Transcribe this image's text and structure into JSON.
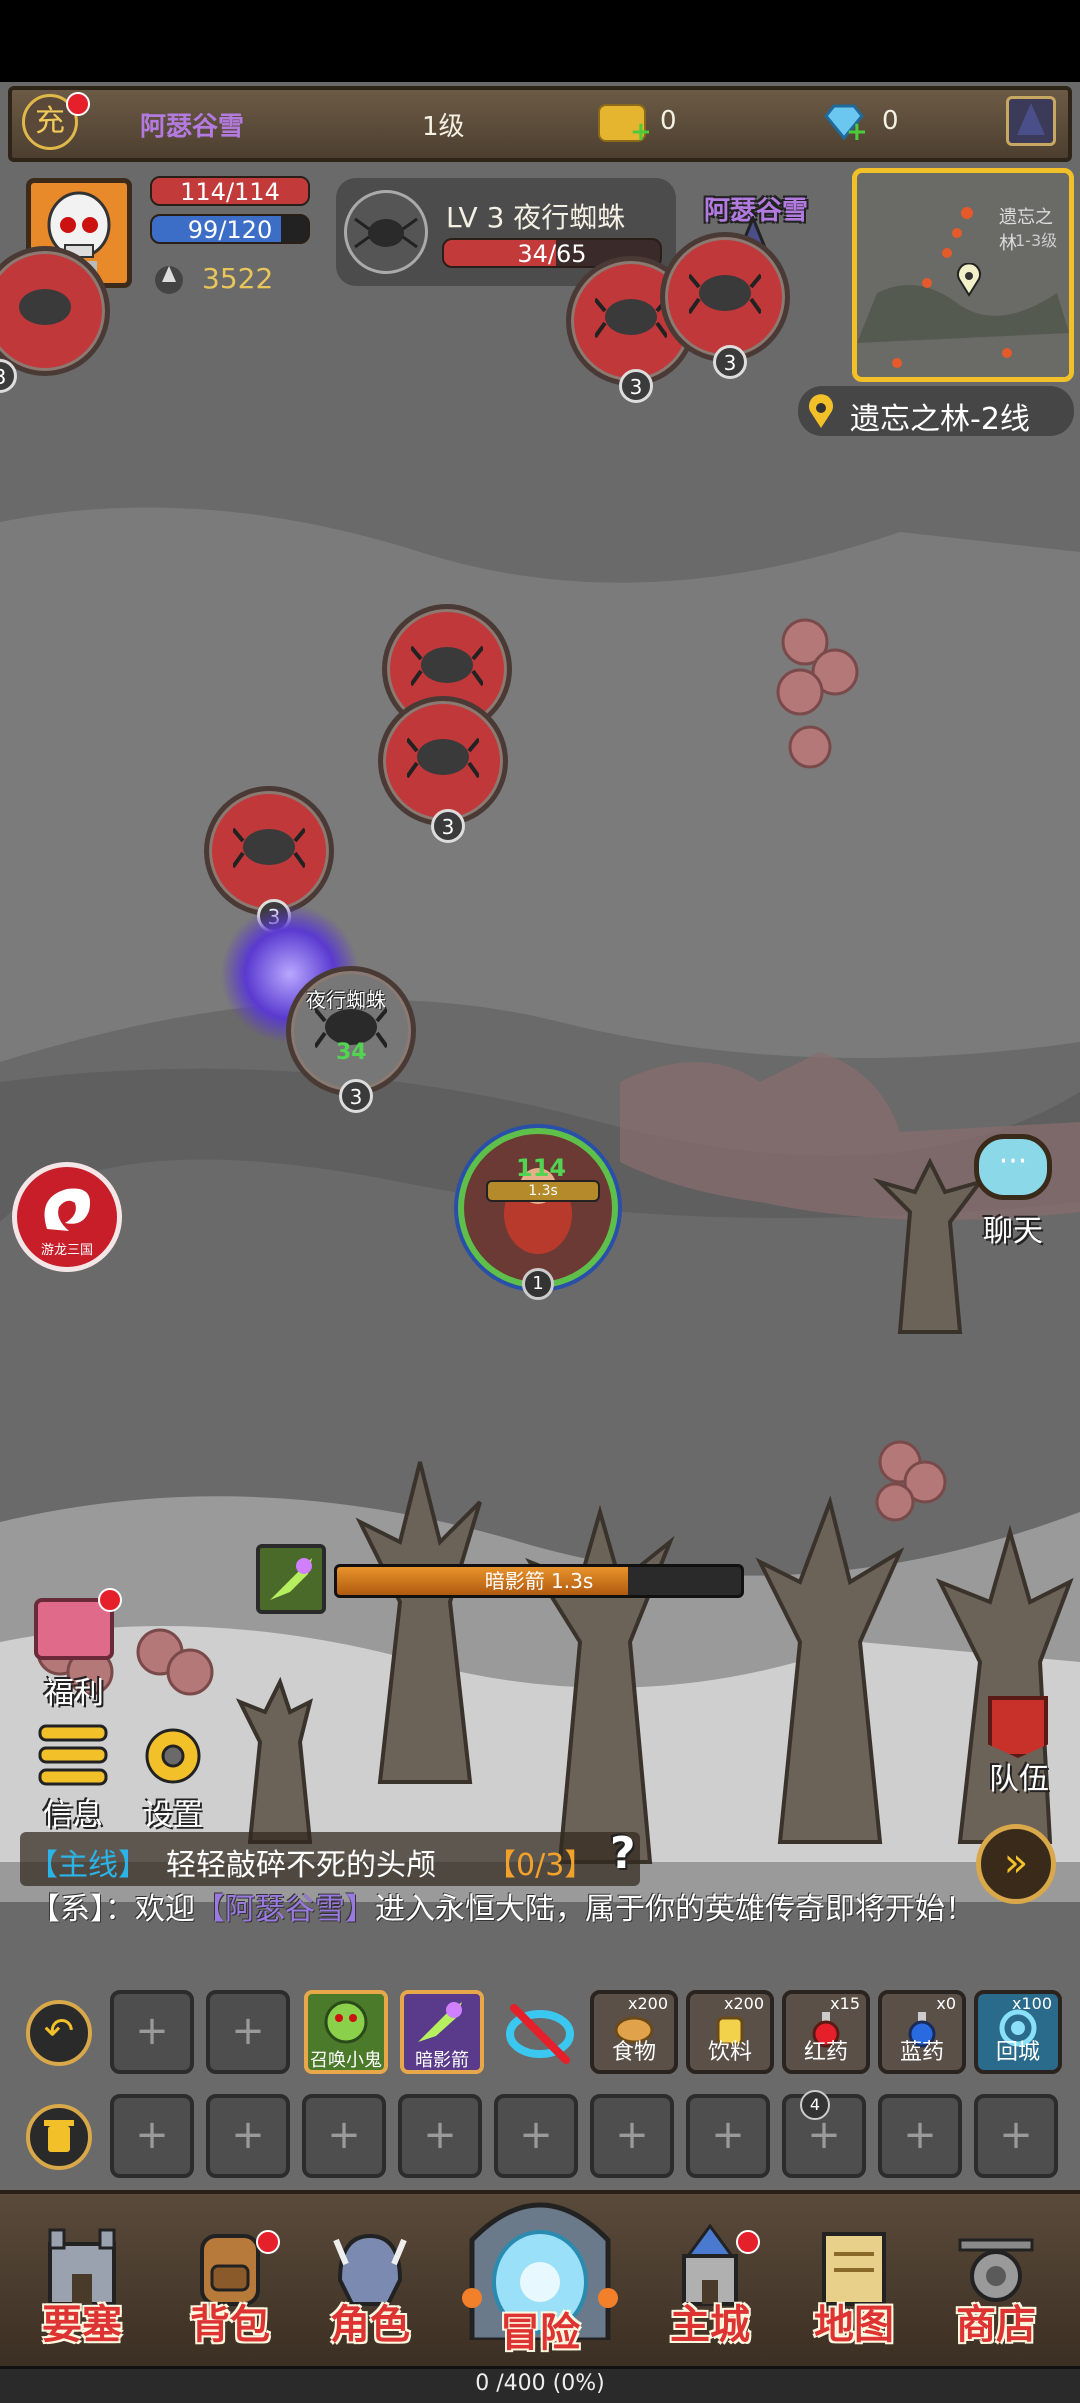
{
  "top_bar": {
    "recharge_label": "充",
    "player_name": "阿瑟谷雪",
    "level": "1级",
    "gold": "0",
    "diamond": "0"
  },
  "player": {
    "hp": "114/114",
    "hp_fraction": 1.0,
    "mp": "99/120",
    "mp_fraction": 0.825,
    "power": "3522"
  },
  "target": {
    "name": "LV 3 夜行蜘蛛",
    "hp": "34/65",
    "hp_fraction": 0.52
  },
  "minimap": {
    "map_title": "遗忘之林",
    "level_range": "1-3级",
    "location": "遗忘之林-2线"
  },
  "field": {
    "other_player_name": "阿瑟谷雪",
    "other_player_hp": "114",
    "enemy_level": "3",
    "enemy_name": "夜行蜘蛛",
    "damage_number": "34",
    "hero_hp": "114",
    "hero_cast": "1.3s",
    "hero_level": "1",
    "stack_count": "4"
  },
  "cast_bar": {
    "label": "暗影箭  1.3s",
    "progress": 0.72
  },
  "side_buttons": {
    "promo_badge": "游龙三国",
    "chat": "聊天",
    "welfare": "福利",
    "info": "信息",
    "settings": "设置",
    "team": "队伍"
  },
  "quest": {
    "tag": "【主线】",
    "text": "轻轻敲碎不死的头颅",
    "progress": "【0/3】"
  },
  "system_message": {
    "prefix": "【系】：欢迎",
    "name": "【阿瑟谷雪】",
    "text": "进入永恒大陆，属于你的英雄传奇即将开始！"
  },
  "skill_bar": {
    "empty_symbol": "+",
    "skills": [
      {
        "label": "召唤小鬼"
      },
      {
        "label": "暗影箭"
      }
    ],
    "items": [
      {
        "count": "x200",
        "label": "食物"
      },
      {
        "count": "x200",
        "label": "饮料"
      },
      {
        "count": "x15",
        "label": "红药"
      },
      {
        "count": "x0",
        "label": "蓝药"
      },
      {
        "count": "x100",
        "label": "回城"
      }
    ]
  },
  "bottom_nav": [
    {
      "label": "要塞"
    },
    {
      "label": "背包"
    },
    {
      "label": "角色"
    },
    {
      "label": "冒险"
    },
    {
      "label": "主城"
    },
    {
      "label": "地图"
    },
    {
      "label": "商店"
    }
  ],
  "exp_bar": {
    "text": "0 /400 (0%)",
    "fraction": 0
  }
}
